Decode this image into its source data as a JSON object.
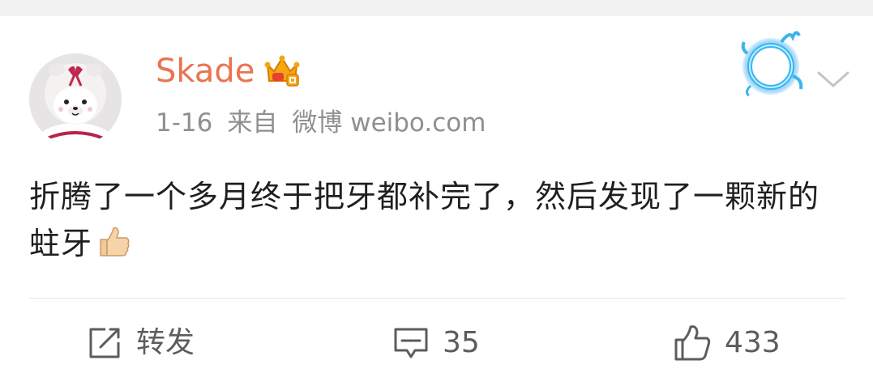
{
  "post": {
    "username": "Skade",
    "date": "1-16",
    "source_prefix": "来自",
    "source_app": "微博 weibo.com",
    "text": "折腾了一个多月终于把牙都补完了，然后发现了一颗新的蛀牙",
    "emoji": "thumbs-up-icon"
  },
  "actions": {
    "repost_label": "转发",
    "comment_count": "35",
    "like_count": "433"
  },
  "icons": {
    "avatar": "bear-avatar",
    "vip": "crown-vip-icon",
    "badge": "blue-fire-ring-icon",
    "more": "chevron-down-icon",
    "repost": "share-icon",
    "comment": "comment-icon",
    "like": "thumbs-up-outline-icon"
  },
  "colors": {
    "username": "#eb7350",
    "meta_text": "#8f8f8f",
    "body_text": "#1f1f1f",
    "action_text": "#5c5c5c",
    "divider": "#e6e6e6",
    "top_strip": "#f2f2f2",
    "badge_blue": "#3ab4ef"
  }
}
